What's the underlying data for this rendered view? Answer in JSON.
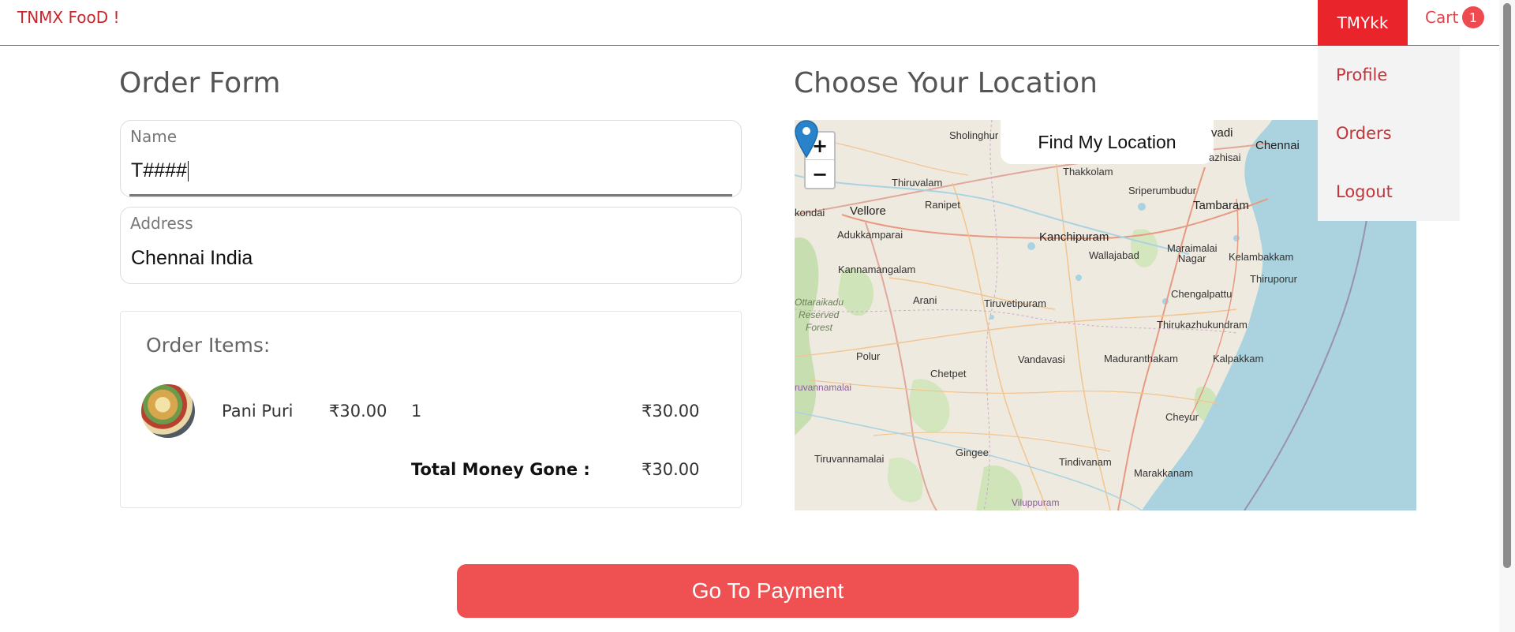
{
  "navbar": {
    "brand": "TNMX FooD !",
    "user_label": "TMYkk",
    "cart_label": "Cart",
    "cart_count": "1",
    "accent_color": "#e9242a"
  },
  "dropdown": {
    "items": [
      "Profile",
      "Orders",
      "Logout"
    ]
  },
  "order_form": {
    "title": "Order Form",
    "name_label": "Name",
    "name_value": "T####",
    "address_label": "Address",
    "address_value": "Chennai India"
  },
  "order_items": {
    "title": "Order Items:",
    "items": [
      {
        "name": "Pani Puri",
        "price": "₹30.00",
        "qty": "1",
        "subtotal": "₹30.00",
        "image_icon": "pani-puri-food-image"
      }
    ],
    "total_label": "Total Money Gone :",
    "total_value": "₹30.00"
  },
  "location": {
    "title": "Choose Your Location",
    "find_button": "Find My Location",
    "zoom_in": "+",
    "zoom_out": "−",
    "map_labels": {
      "sholinghur": "Sholinghur",
      "avadi": "vadi",
      "chennai": "Chennai",
      "kazhisai": "azhisai",
      "thakkolam": "Thakkolam",
      "thiruvalam": "Thiruvalam",
      "sriperumbudur": "Sriperumbudur",
      "kondai": "kondai",
      "vellore": "Vellore",
      "ranipet": "Ranipet",
      "tambaram": "Tambaram",
      "adukkamparai": "Adukkamparai",
      "kanchipuram": "Kanchipuram",
      "wallajabad": "Wallajabad",
      "maraimalai": "Maraimalai",
      "nagar": "Nagar",
      "kelambakkam": "Kelambakkam",
      "kannamangalam": "Kannamangalam",
      "thiruporur": "Thiruporur",
      "chengalpattu": "Chengalpattu",
      "ottaraikadu": "Ottaraikadu",
      "reserved": "Reserved",
      "forest": "Forest",
      "arani": "Arani",
      "tiruvetipuram": "Tiruvetipuram",
      "thirukazhukundram": "Thirukazhukundram",
      "polur": "Polur",
      "vandavasi": "Vandavasi",
      "maduranthakam": "Maduranthakam",
      "kalpakkam": "Kalpakkam",
      "chetpet": "Chetpet",
      "tiruvannamalai_top": "ruvannamalai",
      "cheyur": "Cheyur",
      "gingee": "Gingee",
      "tiruvannamalai": "Tiruvannamalai",
      "tindivanam": "Tindivanam",
      "marakkanam": "Marakkanam",
      "viluppuram": "Viluppuram"
    }
  },
  "payment": {
    "button_label": "Go To Payment",
    "button_color": "#ef5153"
  }
}
